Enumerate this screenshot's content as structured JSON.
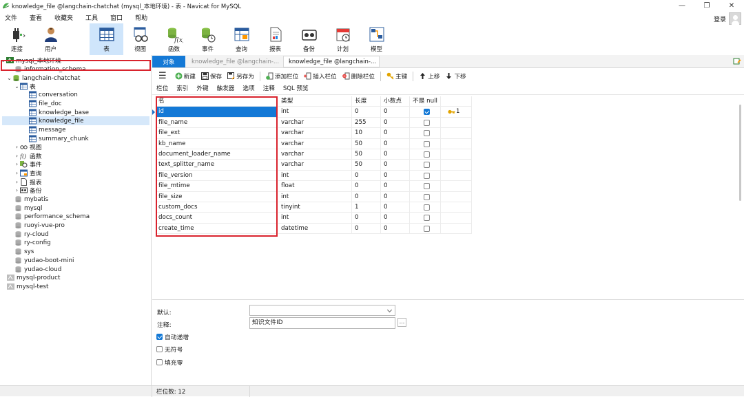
{
  "window": {
    "title": "knowledge_file @langchain-chatchat (mysql_本地环境) - 表 - Navicat for MySQL",
    "minimize": "—",
    "maximize": "❐",
    "close": "✕"
  },
  "menu": [
    "文件",
    "查看",
    "收藏夹",
    "工具",
    "窗口",
    "帮助"
  ],
  "login_label": "登录",
  "toolbar": [
    "连接",
    "用户",
    "表",
    "视图",
    "函数",
    "事件",
    "查询",
    "报表",
    "备份",
    "计划",
    "模型"
  ],
  "tree": {
    "connection": "mysql_本地环境",
    "db_info": "information_schema",
    "db_active": "langchain-chatchat",
    "tables_group": "表",
    "tables": [
      "conversation",
      "file_doc",
      "knowledge_base",
      "knowledge_file",
      "message",
      "summary_chunk"
    ],
    "groups": [
      "视图",
      "函数",
      "事件",
      "查询",
      "报表",
      "备份"
    ],
    "databases": [
      "mybatis",
      "mysql",
      "performance_schema",
      "ruoyi-vue-pro",
      "ry-cloud",
      "ry-config",
      "sys",
      "yudao-boot-mini",
      "yudao-cloud"
    ],
    "connections": [
      "mysql-product",
      "mysql-test"
    ]
  },
  "tabs": {
    "objects": "对象",
    "tab1": "knowledge_file @langchain-...",
    "tab2": "knowledge_file @langchain-..."
  },
  "actions": {
    "new": "新建",
    "save": "保存",
    "save_as": "另存为",
    "add_field": "添加栏位",
    "insert_field": "插入栏位",
    "delete_field": "删除栏位",
    "primary_key": "主键",
    "move_up": "上移",
    "move_down": "下移"
  },
  "subtabs": [
    "栏位",
    "索引",
    "外键",
    "触发器",
    "选项",
    "注释",
    "SQL 预览"
  ],
  "grid": {
    "headers": {
      "name": "名",
      "type": "类型",
      "length": "长度",
      "decimals": "小数点",
      "not_null": "不是 null"
    },
    "rows": [
      {
        "name": "id",
        "type": "int",
        "length": "0",
        "decimals": "0",
        "not_null": true,
        "key": "1"
      },
      {
        "name": "file_name",
        "type": "varchar",
        "length": "255",
        "decimals": "0",
        "not_null": false,
        "key": ""
      },
      {
        "name": "file_ext",
        "type": "varchar",
        "length": "10",
        "decimals": "0",
        "not_null": false,
        "key": ""
      },
      {
        "name": "kb_name",
        "type": "varchar",
        "length": "50",
        "decimals": "0",
        "not_null": false,
        "key": ""
      },
      {
        "name": "document_loader_name",
        "type": "varchar",
        "length": "50",
        "decimals": "0",
        "not_null": false,
        "key": ""
      },
      {
        "name": "text_splitter_name",
        "type": "varchar",
        "length": "50",
        "decimals": "0",
        "not_null": false,
        "key": ""
      },
      {
        "name": "file_version",
        "type": "int",
        "length": "0",
        "decimals": "0",
        "not_null": false,
        "key": ""
      },
      {
        "name": "file_mtime",
        "type": "float",
        "length": "0",
        "decimals": "0",
        "not_null": false,
        "key": ""
      },
      {
        "name": "file_size",
        "type": "int",
        "length": "0",
        "decimals": "0",
        "not_null": false,
        "key": ""
      },
      {
        "name": "custom_docs",
        "type": "tinyint",
        "length": "1",
        "decimals": "0",
        "not_null": false,
        "key": ""
      },
      {
        "name": "docs_count",
        "type": "int",
        "length": "0",
        "decimals": "0",
        "not_null": false,
        "key": ""
      },
      {
        "name": "create_time",
        "type": "datetime",
        "length": "0",
        "decimals": "0",
        "not_null": false,
        "key": ""
      }
    ]
  },
  "props": {
    "default_label": "默认:",
    "comment_label": "注释:",
    "comment_value": "知识文件ID",
    "dots": "...",
    "auto_increment": "自动递增",
    "unsigned": "无符号",
    "zerofill": "填充零"
  },
  "status": "栏位数: 12",
  "colors": {
    "accent": "#1479d6",
    "highlight": "#d9232d",
    "selected_bg": "#d6e8fa"
  }
}
